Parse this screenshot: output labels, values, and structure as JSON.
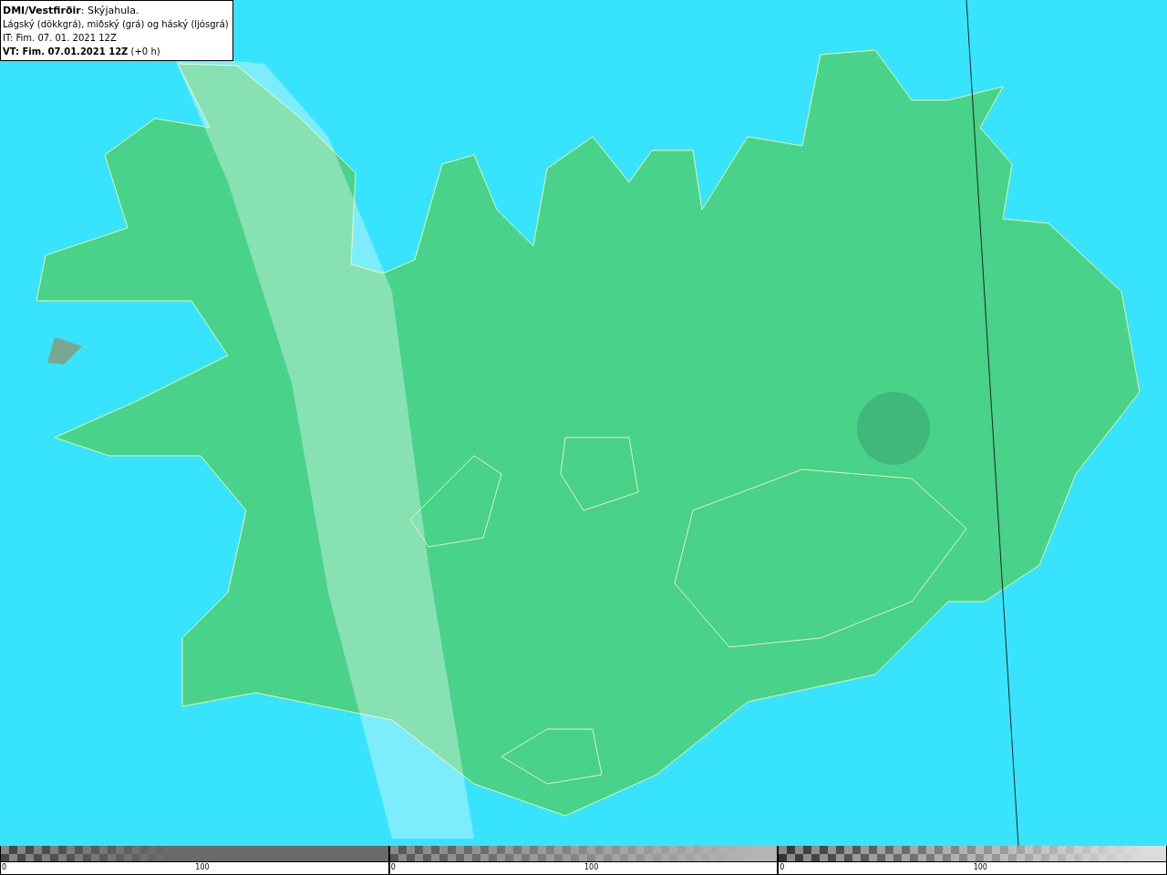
{
  "legend": {
    "lines": [
      "**DMI/Vestfirðir**: Skýjahula.",
      "Lágský (dökkgrá), miðský (grá) og háský (ljósgrá)",
      "IT: Fim. 07. 01. 2021 12Z",
      "**VT: Fim. 07.01.2021 12Z** (+0 h)"
    ]
  },
  "scales": [
    {
      "kind": "low",
      "ticks": [
        "0",
        "100"
      ]
    },
    {
      "kind": "mid",
      "ticks": [
        "0",
        "100"
      ]
    },
    {
      "kind": "high",
      "ticks": [
        "0",
        "100"
      ]
    }
  ]
}
